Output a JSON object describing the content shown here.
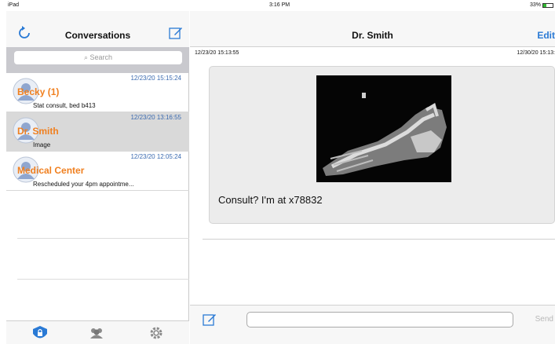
{
  "status_bar": {
    "device": "iPad",
    "time": "3:16 PM",
    "battery": "33%",
    "battery_level": 0.33
  },
  "sidebar": {
    "title": "Conversations",
    "search_placeholder": "Search",
    "conversations": [
      {
        "name": "Becky (1)",
        "time": "12/23/20 15:15:24",
        "preview": "Stat consult, bed b413",
        "selected": false
      },
      {
        "name": "Dr. Smith",
        "time": "12/23/20 13:16:55",
        "preview": "Image",
        "selected": true
      },
      {
        "name": "Medical Center",
        "time": "12/23/20 12:05:24",
        "preview": "Rescheduled your 4pm appointme...",
        "selected": false
      }
    ],
    "tabs": [
      "lock-icon",
      "group-icon",
      "gear-icon"
    ]
  },
  "chat": {
    "title": "Dr. Smith",
    "edit_label": "Edit",
    "left_timestamp": "12/23/20 15:13:55",
    "right_timestamp": "12/30/20 15:13:",
    "message_text": "Consult? I'm at x78832",
    "send_label": "Send",
    "input_value": ""
  },
  "colors": {
    "accent": "#2a7ad5",
    "name": "#f08020",
    "time": "#3a6ab0"
  }
}
